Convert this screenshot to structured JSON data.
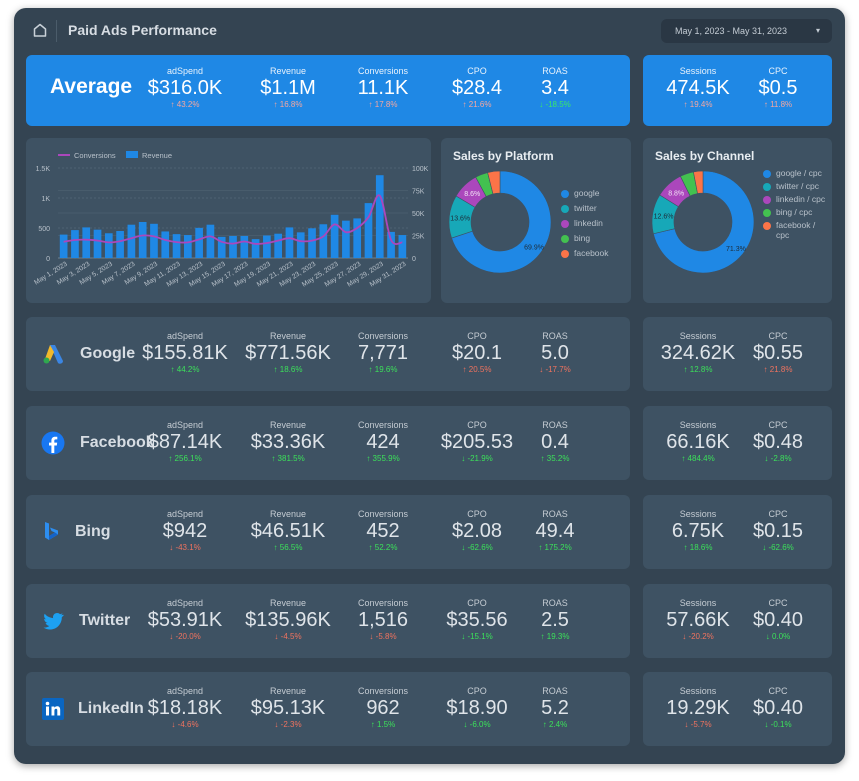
{
  "header": {
    "title": "Paid Ads Performance",
    "date_range": "May 1, 2023 - May 31, 2023",
    "home_icon": "home-icon",
    "dropdown_icon": "caret-down-icon"
  },
  "average": {
    "label": "Average",
    "metrics": [
      {
        "label": "adSpend",
        "value": "$316.0K",
        "change": "43.2%",
        "dir": "up",
        "tone": "pinkish"
      },
      {
        "label": "Revenue",
        "value": "$1.1M",
        "change": "16.8%",
        "dir": "up",
        "tone": "pinkish"
      },
      {
        "label": "Conversions",
        "value": "11.1K",
        "change": "17.8%",
        "dir": "up",
        "tone": "pinkish"
      },
      {
        "label": "CPO",
        "value": "$28.4",
        "change": "21.6%",
        "dir": "up",
        "tone": "pinkish"
      },
      {
        "label": "ROAS",
        "value": "3.4",
        "change": "-18.5%",
        "dir": "down",
        "tone": "greenish"
      }
    ],
    "side": [
      {
        "label": "Sessions",
        "value": "474.5K",
        "change": "19.4%",
        "dir": "up",
        "tone": "pinkish"
      },
      {
        "label": "CPC",
        "value": "$0.5",
        "change": "11.8%",
        "dir": "up",
        "tone": "pinkish"
      }
    ]
  },
  "platforms": [
    {
      "name": "Google",
      "icon": "google-ads-icon",
      "metrics": [
        {
          "label": "adSpend",
          "value": "$155.81K",
          "change": "44.2%",
          "dir": "up",
          "tone": "pos"
        },
        {
          "label": "Revenue",
          "value": "$771.56K",
          "change": "18.6%",
          "dir": "up",
          "tone": "pos"
        },
        {
          "label": "Conversions",
          "value": "7,771",
          "change": "19.6%",
          "dir": "up",
          "tone": "pos"
        },
        {
          "label": "CPO",
          "value": "$20.1",
          "change": "20.5%",
          "dir": "up",
          "tone": "neg"
        },
        {
          "label": "ROAS",
          "value": "5.0",
          "change": "-17.7%",
          "dir": "down",
          "tone": "neg"
        }
      ],
      "side": [
        {
          "label": "Sessions",
          "value": "324.62K",
          "change": "12.8%",
          "dir": "up",
          "tone": "pos"
        },
        {
          "label": "CPC",
          "value": "$0.55",
          "change": "21.8%",
          "dir": "up",
          "tone": "neg"
        }
      ]
    },
    {
      "name": "Facebook",
      "icon": "facebook-icon",
      "metrics": [
        {
          "label": "adSpend",
          "value": "$87.14K",
          "change": "256.1%",
          "dir": "up",
          "tone": "pos"
        },
        {
          "label": "Revenue",
          "value": "$33.36K",
          "change": "381.5%",
          "dir": "up",
          "tone": "pos"
        },
        {
          "label": "Conversions",
          "value": "424",
          "change": "355.9%",
          "dir": "up",
          "tone": "pos"
        },
        {
          "label": "CPO",
          "value": "$205.53",
          "change": "-21.9%",
          "dir": "down",
          "tone": "pos"
        },
        {
          "label": "ROAS",
          "value": "0.4",
          "change": "35.2%",
          "dir": "up",
          "tone": "pos"
        }
      ],
      "side": [
        {
          "label": "Sessions",
          "value": "66.16K",
          "change": "484.4%",
          "dir": "up",
          "tone": "pos"
        },
        {
          "label": "CPC",
          "value": "$0.48",
          "change": "-2.8%",
          "dir": "down",
          "tone": "pos"
        }
      ]
    },
    {
      "name": "Bing",
      "icon": "bing-icon",
      "metrics": [
        {
          "label": "adSpend",
          "value": "$942",
          "change": "-43.1%",
          "dir": "down",
          "tone": "neg"
        },
        {
          "label": "Revenue",
          "value": "$46.51K",
          "change": "56.5%",
          "dir": "up",
          "tone": "pos"
        },
        {
          "label": "Conversions",
          "value": "452",
          "change": "52.2%",
          "dir": "up",
          "tone": "pos"
        },
        {
          "label": "CPO",
          "value": "$2.08",
          "change": "-62.6%",
          "dir": "down",
          "tone": "pos"
        },
        {
          "label": "ROAS",
          "value": "49.4",
          "change": "175.2%",
          "dir": "up",
          "tone": "pos"
        }
      ],
      "side": [
        {
          "label": "Sessions",
          "value": "6.75K",
          "change": "18.6%",
          "dir": "up",
          "tone": "pos"
        },
        {
          "label": "CPC",
          "value": "$0.15",
          "change": "-62.6%",
          "dir": "down",
          "tone": "pos"
        }
      ]
    },
    {
      "name": "Twitter",
      "icon": "twitter-icon",
      "metrics": [
        {
          "label": "adSpend",
          "value": "$53.91K",
          "change": "-20.0%",
          "dir": "down",
          "tone": "neg"
        },
        {
          "label": "Revenue",
          "value": "$135.96K",
          "change": "-4.5%",
          "dir": "down",
          "tone": "neg"
        },
        {
          "label": "Conversions",
          "value": "1,516",
          "change": "-5.8%",
          "dir": "down",
          "tone": "neg"
        },
        {
          "label": "CPO",
          "value": "$35.56",
          "change": "-15.1%",
          "dir": "down",
          "tone": "pos"
        },
        {
          "label": "ROAS",
          "value": "2.5",
          "change": "19.3%",
          "dir": "up",
          "tone": "pos"
        }
      ],
      "side": [
        {
          "label": "Sessions",
          "value": "57.66K",
          "change": "-20.2%",
          "dir": "down",
          "tone": "neg"
        },
        {
          "label": "CPC",
          "value": "$0.40",
          "change": "0.0%",
          "dir": "down",
          "tone": "pos"
        }
      ]
    },
    {
      "name": "LinkedIn",
      "icon": "linkedin-icon",
      "metrics": [
        {
          "label": "adSpend",
          "value": "$18.18K",
          "change": "-4.6%",
          "dir": "down",
          "tone": "neg"
        },
        {
          "label": "Revenue",
          "value": "$95.13K",
          "change": "-2.3%",
          "dir": "down",
          "tone": "neg"
        },
        {
          "label": "Conversions",
          "value": "962",
          "change": "1.5%",
          "dir": "up",
          "tone": "pos"
        },
        {
          "label": "CPO",
          "value": "$18.90",
          "change": "-6.0%",
          "dir": "down",
          "tone": "pos"
        },
        {
          "label": "ROAS",
          "value": "5.2",
          "change": "2.4%",
          "dir": "up",
          "tone": "pos"
        }
      ],
      "side": [
        {
          "label": "Sessions",
          "value": "19.29K",
          "change": "-5.7%",
          "dir": "down",
          "tone": "neg"
        },
        {
          "label": "CPC",
          "value": "$0.40",
          "change": "-0.1%",
          "dir": "down",
          "tone": "pos"
        }
      ]
    }
  ],
  "colors": {
    "accent": "#1f88e5",
    "positive": "#3ce05a",
    "negative": "#f0735f",
    "line": "#ab47bc"
  },
  "chart_data": [
    {
      "type": "bar",
      "title": "",
      "legend": [
        "Conversions",
        "Revenue"
      ],
      "legend_position": "top-left",
      "categories": [
        "May 1, 2023",
        "May 2, 2023",
        "May 3, 2023",
        "May 4, 2023",
        "May 5, 2023",
        "May 6, 2023",
        "May 7, 2023",
        "May 8, 2023",
        "May 9, 2023",
        "May 10, 2023",
        "May 11, 2023",
        "May 12, 2023",
        "May 13, 2023",
        "May 14, 2023",
        "May 15, 2023",
        "May 16, 2023",
        "May 17, 2023",
        "May 18, 2023",
        "May 19, 2023",
        "May 20, 2023",
        "May 21, 2023",
        "May 22, 2023",
        "May 23, 2023",
        "May 24, 2023",
        "May 25, 2023",
        "May 26, 2023",
        "May 27, 2023",
        "May 28, 2023",
        "May 29, 2023",
        "May 30, 2023",
        "May 31, 2023"
      ],
      "xtick_labels": [
        "May 1, 2023",
        "May 3, 2023",
        "May 5, 2023",
        "May 7, 2023",
        "May 9, 2023",
        "May 11, 2023",
        "May 13, 2023",
        "May 15, 2023",
        "May 17, 2023",
        "May 19, 2023",
        "May 21, 2023",
        "May 23, 2023",
        "May 25, 2023",
        "May 27, 2023",
        "May 29, 2023",
        "May 31, 2023"
      ],
      "series": [
        {
          "name": "Revenue",
          "kind": "bar",
          "axis": "right",
          "values": [
            26000,
            31000,
            34000,
            31500,
            27500,
            30000,
            37000,
            40000,
            38000,
            29500,
            26500,
            25500,
            33500,
            37000,
            23500,
            24500,
            24500,
            21000,
            25000,
            27000,
            34000,
            28500,
            33000,
            37500,
            48000,
            41500,
            44000,
            61000,
            92000,
            29000,
            25500
          ]
        },
        {
          "name": "Conversions",
          "kind": "line",
          "axis": "left",
          "values": [
            270,
            300,
            305,
            290,
            260,
            280,
            330,
            375,
            360,
            300,
            265,
            260,
            310,
            360,
            270,
            240,
            275,
            235,
            250,
            290,
            330,
            280,
            290,
            360,
            560,
            430,
            500,
            680,
            1040,
            300,
            260
          ]
        }
      ],
      "ylim_left": [
        0,
        1500
      ],
      "yticks_left": [
        "0",
        "500",
        "1K",
        "1.5K"
      ],
      "ylim_right": [
        0,
        100000
      ],
      "yticks_right": [
        "0",
        "25K",
        "50K",
        "75K",
        "100K"
      ],
      "grid": true
    },
    {
      "type": "pie",
      "title": "Sales by Platform",
      "legend_position": "right",
      "labels": [
        "google",
        "twitter",
        "linkedin",
        "bing",
        "facebook"
      ],
      "values": [
        69.9,
        13.6,
        8.6,
        4.0,
        3.9
      ],
      "shown_labels": [
        "69.9%",
        "13.6%",
        "8.6%",
        "",
        ""
      ],
      "colors": [
        "#1f88e5",
        "#17a8b8",
        "#ab47bc",
        "#43c150",
        "#fb7448"
      ]
    },
    {
      "type": "pie",
      "title": "Sales by Channel",
      "legend_position": "right",
      "labels": [
        "google / cpc",
        "twitter / cpc",
        "linkedin / cpc",
        "bing / cpc",
        "facebook / cpc"
      ],
      "values": [
        71.3,
        12.6,
        8.8,
        4.3,
        3.0
      ],
      "shown_labels": [
        "71.3%",
        "12.6%",
        "8.8%",
        "",
        ""
      ],
      "colors": [
        "#1f88e5",
        "#17a8b8",
        "#ab47bc",
        "#43c150",
        "#fb7448"
      ]
    }
  ]
}
